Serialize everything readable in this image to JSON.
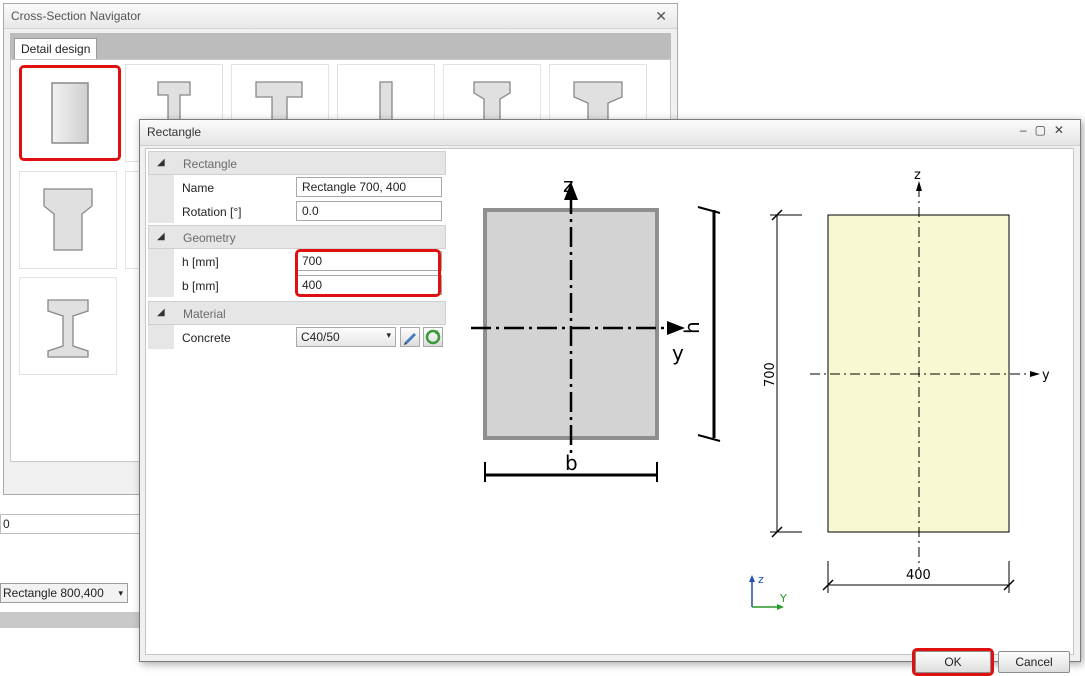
{
  "navigator": {
    "title": "Cross-Section Navigator",
    "close_glyph": "✕",
    "tab_label": "Detail design"
  },
  "background": {
    "field_value": "0",
    "combo_value": "Rectangle 800,400"
  },
  "dialog": {
    "title": "Rectangle",
    "window_buttons": "–▢✕",
    "sections": {
      "rectangle": "Rectangle",
      "geometry": "Geometry",
      "material": "Material"
    },
    "properties": {
      "name_label": "Name",
      "name_value": "Rectangle 700, 400",
      "rotation_label": "Rotation [°]",
      "rotation_value": "0.0",
      "h_label": "h [mm]",
      "h_value": "700",
      "b_label": "b [mm]",
      "b_value": "400",
      "concrete_label": "Concrete",
      "concrete_value": "C40/50"
    },
    "schematic": {
      "z_label": "z",
      "y_label": "y",
      "h_label": "h",
      "b_label": "b"
    },
    "drawing": {
      "z_label": "z",
      "y_label": "y",
      "height_dim": "700",
      "width_dim": "400",
      "axis_z": "z",
      "axis_y": "Y"
    },
    "buttons": {
      "ok": "OK",
      "cancel": "Cancel"
    }
  },
  "colors": {
    "highlight": "#e01010",
    "section_fill": "#f8f8d2",
    "schematic_fill": "#d3d3d3"
  }
}
